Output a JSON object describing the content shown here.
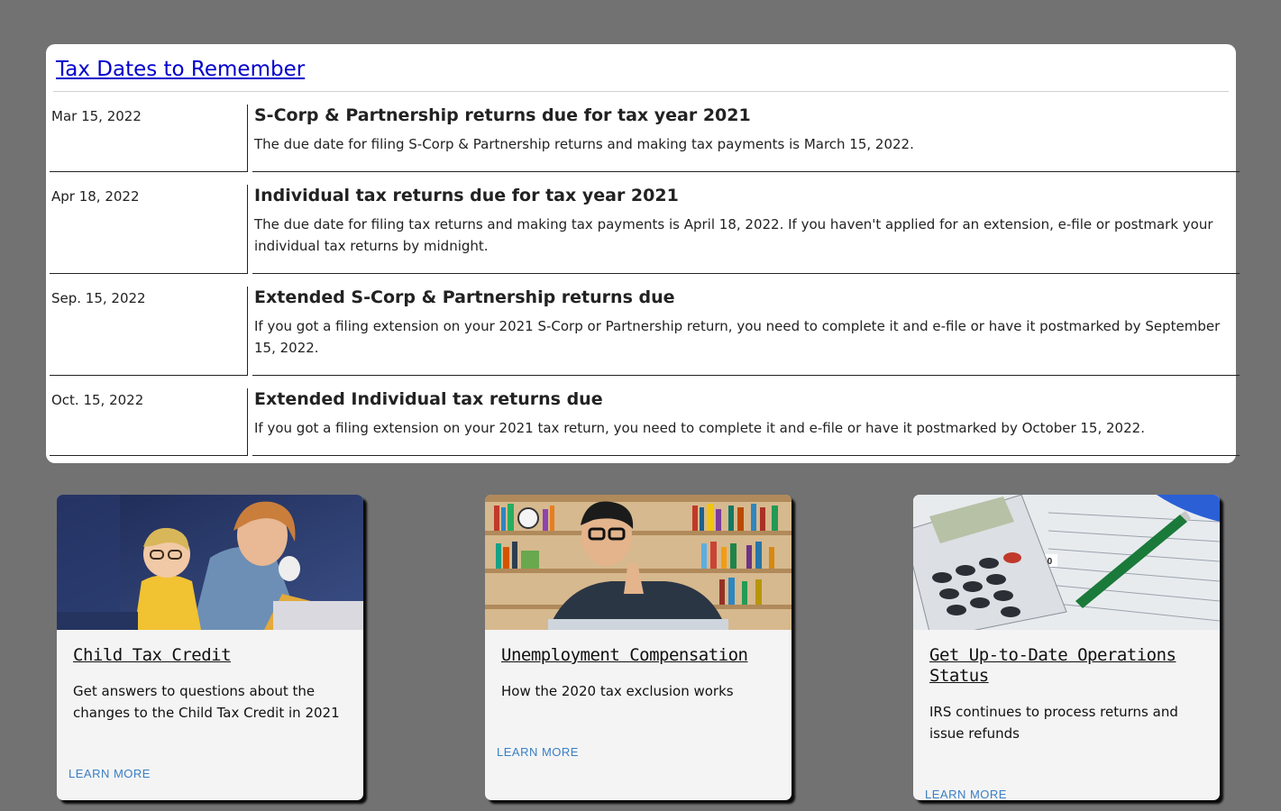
{
  "tax_dates": {
    "title": "Tax Dates to Remember",
    "rows": [
      {
        "date": "Mar 15, 2022",
        "title": "S-Corp & Partnership returns due for tax year 2021",
        "description": "The due date for filing S-Corp & Partnership returns and making tax payments is March 15, 2022."
      },
      {
        "date": "Apr 18, 2022",
        "title": "Individual tax returns due for tax year 2021",
        "description": "The due date for filing tax returns and making tax payments is April 18, 2022. If you haven't applied for an extension, e-file or postmark your individual tax returns by midnight."
      },
      {
        "date": "Sep. 15, 2022",
        "title": "Extended S-Corp & Partnership returns due",
        "description": "If you got a filing extension on your 2021 S-Corp or Partnership return, you need to complete it and e-file or have it postmarked by September 15, 2022."
      },
      {
        "date": "Oct. 15, 2022",
        "title": "Extended Individual tax returns due",
        "description": "If you got a filing extension on your 2021 tax return, you need to complete it and e-file or have it postmarked by October 15, 2022."
      }
    ]
  },
  "cards": [
    {
      "title": "Child Tax Credit",
      "description": "Get answers to questions about the changes to the Child Tax Credit in 2021",
      "link": "LEARN MORE"
    },
    {
      "title": "Unemployment Compensation",
      "description": "How the 2020 tax exclusion works",
      "link": "LEARN MORE"
    },
    {
      "title": "Get Up-to-Date Operations Status",
      "description": "IRS continues to process returns and issue refunds",
      "link": "LEARN MORE"
    }
  ]
}
